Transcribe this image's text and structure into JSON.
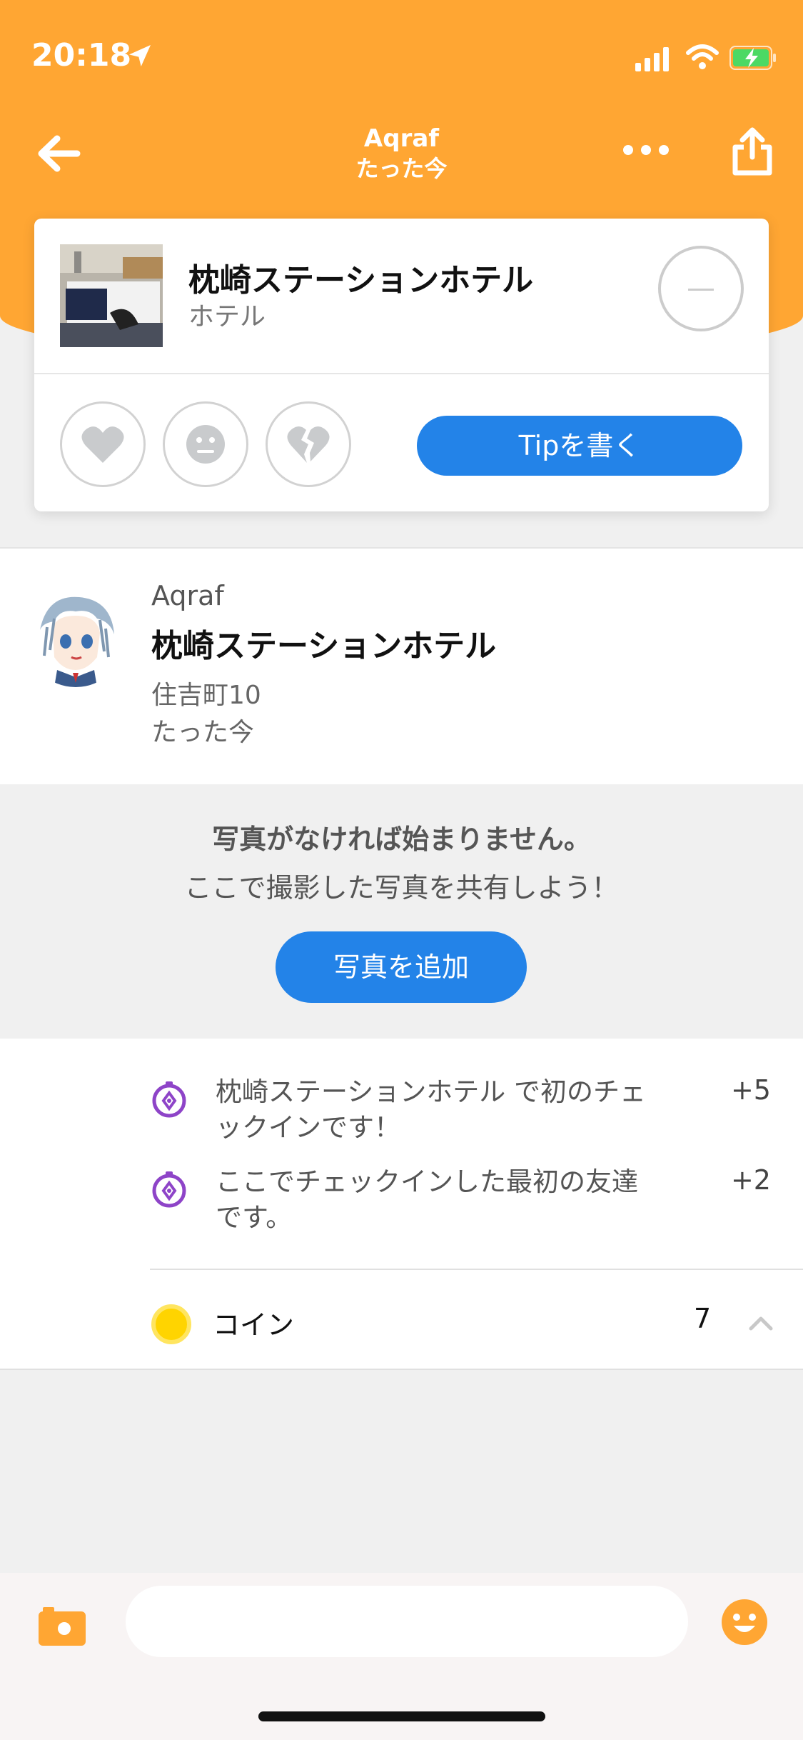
{
  "status_bar": {
    "time": "20:18",
    "icons": [
      "location-arrow-icon",
      "signal-icon",
      "wifi-icon",
      "battery-charging-icon"
    ]
  },
  "nav": {
    "title": "Aqraf",
    "subtitle": "たった今",
    "back_icon": "arrow-left-icon",
    "more_icon": "more-dots-icon",
    "share_icon": "share-icon"
  },
  "venue_card": {
    "name": "枕崎ステーションホテル",
    "category": "ホテル",
    "rating_icons": [
      "heart-icon",
      "neutral-face-icon",
      "broken-heart-icon"
    ],
    "tip_button": "Tipを書く"
  },
  "checkin": {
    "user": "Aqraf",
    "venue": "枕崎ステーションホテル",
    "address": "住吉町10",
    "time": "たった今"
  },
  "photo_prompt": {
    "title": "写真がなければ始まりません。",
    "subtitle": "ここで撮影した写真を共有しよう！",
    "button": "写真を追加"
  },
  "rewards": {
    "items": [
      {
        "text": "枕崎ステーションホテル で初のチェックインです！",
        "points": "+5"
      },
      {
        "text": "ここでチェックインした最初の友達です。",
        "points": "+2"
      }
    ],
    "coin_label": "コイン",
    "coin_count": "7"
  },
  "bottom_bar": {
    "comment_placeholder": ""
  },
  "colors": {
    "brand_orange": "#ffa633",
    "accent_blue": "#2383e8",
    "reward_purple": "#8e44c8",
    "coin_yellow": "#ffd400"
  }
}
